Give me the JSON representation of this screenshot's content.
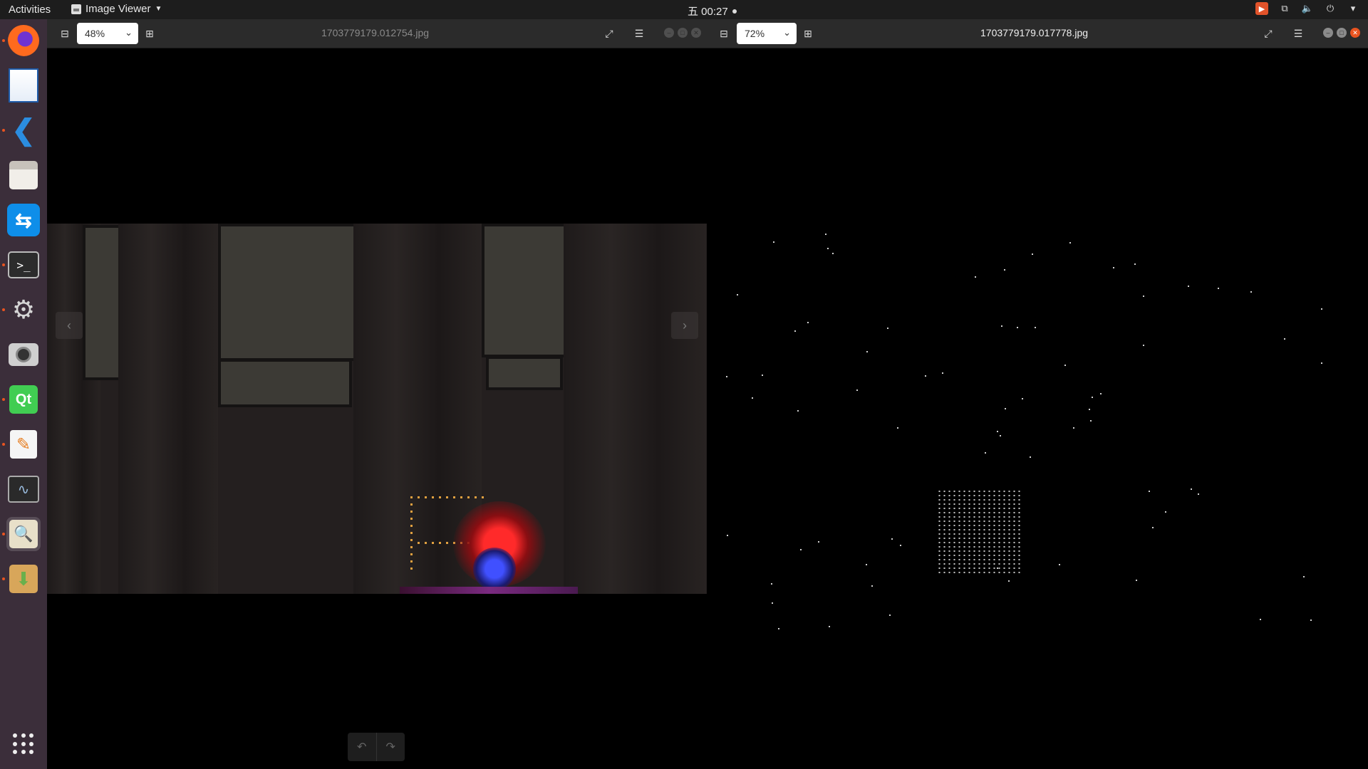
{
  "topbar": {
    "activities": "Activities",
    "app_menu": "Image Viewer",
    "clock": "五 00:27",
    "tray_icons": [
      "screenshot-tool-icon",
      "network-icon",
      "volume-icon",
      "power-icon",
      "menu-caret-icon"
    ]
  },
  "dock": {
    "apps": [
      "firefox",
      "libreoffice-writer",
      "visual-studio-code",
      "files",
      "teamviewer",
      "terminal",
      "system-settings",
      "cheese-camera",
      "qt-creator",
      "text-editor",
      "system-monitor",
      "image-viewer",
      "software-install"
    ],
    "terminal_glyph": ">_",
    "qt_glyph": "Qt"
  },
  "left_viewer": {
    "zoom": "48%",
    "filename": "1703779179.012754.jpg"
  },
  "right_viewer": {
    "zoom": "72%",
    "filename": "1703779179.017778.jpg"
  },
  "colors": {
    "accent": "#e95420",
    "dock_bg": "#3b2e3a",
    "header_bg": "#2b2b2b"
  }
}
